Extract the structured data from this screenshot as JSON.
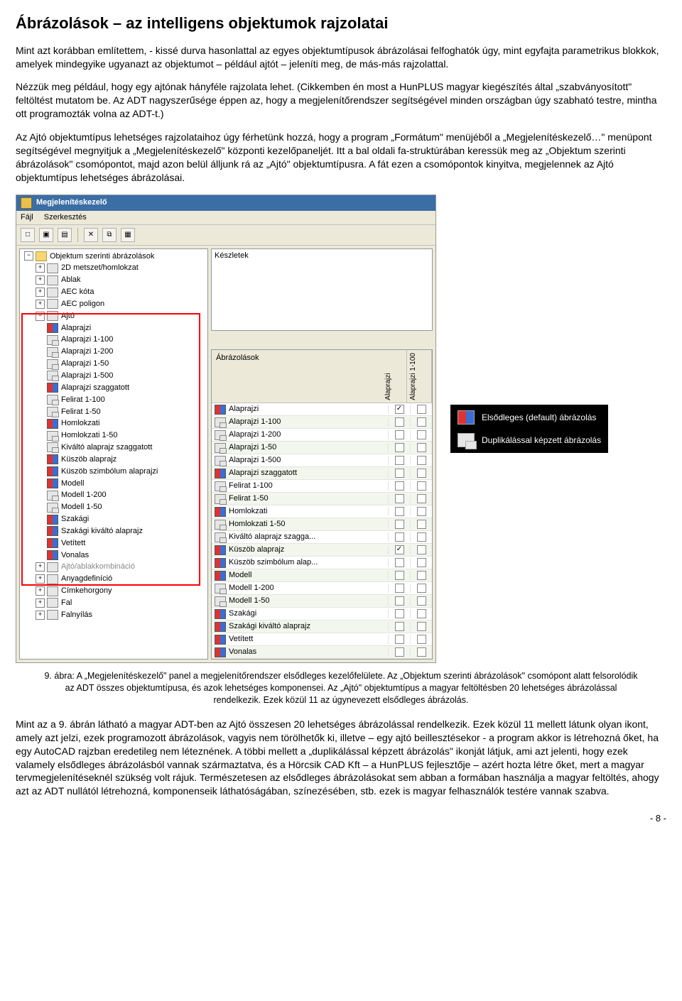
{
  "title": "Ábrázolások – az intelligens objektumok rajzolatai",
  "para1": "Mint azt korábban említettem, - kissé durva hasonlattal az egyes objektumtípusok ábrázolásai felfoghatók úgy, mint egyfajta parametrikus blokkok, amelyek mindegyike ugyanazt az objektumot – például ajtót – jeleníti meg, de más-más rajzolattal.",
  "para2": "Nézzük meg például, hogy egy ajtónak hányféle rajzolata lehet. (Cikkemben én most a HunPLUS magyar kiegészítés által „szabványosított\" feltöltést mutatom be. Az ADT nagyszerűsége éppen az, hogy a megjelenítőrendszer segítségével minden országban úgy szabható testre, mintha ott programozták volna az ADT-t.)",
  "para3": "Az Ajtó objektumtípus lehetséges rajzolataihoz úgy férhetünk hozzá, hogy a program „Formátum\" menüjéből a „Megjelenítéskezelő…\" menüpont segítségével megnyitjuk a „Megjelenítéskezelő\" központi kezelőpaneljét. Itt a bal oldali fa-struktúrában keressük meg az „Objektum szerinti ábrázolások\" csomópontot, majd azon belül álljunk rá az „Ajtó\" objektumtípusra. A fát ezen a csomópontok kinyitva, megjelennek az Ajtó objektumtípus lehetséges ábrázolásai.",
  "caption": "9. ábra: A „Megjelenítéskezelő\" panel a megjelenítőrendszer elsődleges kezelőfelülete. Az „Objektum szerinti ábrázolások\" csomópont alatt felsorolódik az ADT összes objektumtípusa, és azok lehetséges komponensei. Az „Ajtó\" objektumtípus a magyar feltöltésben 20 lehetséges ábrázolással rendelkezik. Ezek közül 11 az úgynevezett elsődleges ábrázolás.",
  "para4": "Mint az a 9. ábrán látható a magyar ADT-ben az Ajtó összesen 20 lehetséges ábrázolással rendelkezik. Ezek közül 11 mellett látunk olyan ikont, amely azt jelzi, ezek programozott ábrázolások, vagyis nem törölhetők ki, illetve – egy ajtó beillesztésekor - a program akkor is létrehozná őket, ha egy AutoCAD rajzban eredetileg nem léteznének. A többi mellett a „duplikálással képzett ábrázolás\" ikonját látjuk, ami azt jelenti, hogy ezek valamely elsődleges ábrázolásból vannak származtatva, és a Hörcsik CAD Kft – a HunPLUS fejlesztője – azért hozta létre őket, mert a magyar tervmegjelenítéseknél szükség volt rájuk. Természetesen az elsődleges ábrázolásokat sem abban a formában használja a magyar feltöltés, ahogy azt az ADT nullától létrehozná, komponenseik láthatóságában, színezésében, stb. ezek is magyar felhasználók testére vannak szabva.",
  "page": "- 8 -",
  "ui": {
    "title": "Megjelenítéskezelő",
    "menu": {
      "file": "Fájl",
      "edit": "Szerkesztés"
    },
    "rootNode": "Objektum szerinti ábrázolások",
    "topNodes": [
      "2D metszet/homlokzat",
      "Ablak",
      "AEC kóta",
      "AEC poligon"
    ],
    "ajto": "Ajtó",
    "ajtoChildren": [
      {
        "label": "Alaprajzi",
        "icon": "primary"
      },
      {
        "label": "Alaprajzi 1-100",
        "icon": "dup"
      },
      {
        "label": "Alaprajzi 1-200",
        "icon": "dup"
      },
      {
        "label": "Alaprajzi 1-50",
        "icon": "dup"
      },
      {
        "label": "Alaprajzi 1-500",
        "icon": "dup"
      },
      {
        "label": "Alaprajzi szaggatott",
        "icon": "primary"
      },
      {
        "label": "Felirat 1-100",
        "icon": "dup"
      },
      {
        "label": "Felirat 1-50",
        "icon": "dup"
      },
      {
        "label": "Homlokzati",
        "icon": "primary"
      },
      {
        "label": "Homlokzati 1-50",
        "icon": "dup"
      },
      {
        "label": "Kiváltó alaprajz szaggatott",
        "icon": "dup"
      },
      {
        "label": "Küszöb alaprajz",
        "icon": "primary"
      },
      {
        "label": "Küszöb szimbólum alaprajzi",
        "icon": "primary"
      },
      {
        "label": "Modell",
        "icon": "primary"
      },
      {
        "label": "Modell 1-200",
        "icon": "dup"
      },
      {
        "label": "Modell 1-50",
        "icon": "dup"
      },
      {
        "label": "Szakági",
        "icon": "primary"
      },
      {
        "label": "Szakági kiváltó alaprajz",
        "icon": "primary"
      },
      {
        "label": "Vetített",
        "icon": "primary"
      },
      {
        "label": "Vonalas",
        "icon": "primary"
      }
    ],
    "ajtoTrunc": "Ajtó/ablakkombináció",
    "bottomNodes": [
      "Anyagdefiníció",
      "Címkehorgony",
      "Fal",
      "Falnyílás"
    ],
    "keszletLabel": "Készletek",
    "matrixLabel": "Ábrázolások",
    "colRot1": "Alaprajzi",
    "colRot2": "Alaprajzi 1-100",
    "matrix": [
      {
        "label": "Alaprajzi",
        "icon": "primary",
        "c1": true,
        "c2": false
      },
      {
        "label": "Alaprajzi 1-100",
        "icon": "dup",
        "c1": false,
        "c2": false
      },
      {
        "label": "Alaprajzi 1-200",
        "icon": "dup",
        "c1": false,
        "c2": false
      },
      {
        "label": "Alaprajzi 1-50",
        "icon": "dup",
        "c1": false,
        "c2": false
      },
      {
        "label": "Alaprajzi 1-500",
        "icon": "dup",
        "c1": false,
        "c2": false
      },
      {
        "label": "Alaprajzi szaggatott",
        "icon": "primary",
        "c1": false,
        "c2": false
      },
      {
        "label": "Felirat 1-100",
        "icon": "dup",
        "c1": false,
        "c2": false
      },
      {
        "label": "Felirat 1-50",
        "icon": "dup",
        "c1": false,
        "c2": false
      },
      {
        "label": "Homlokzati",
        "icon": "primary",
        "c1": false,
        "c2": false
      },
      {
        "label": "Homlokzati 1-50",
        "icon": "dup",
        "c1": false,
        "c2": false
      },
      {
        "label": "Kiváltó alaprajz szagga...",
        "icon": "dup",
        "c1": false,
        "c2": false
      },
      {
        "label": "Küszöb alaprajz",
        "icon": "primary",
        "c1": true,
        "c2": false
      },
      {
        "label": "Küszöb szimbólum alap...",
        "icon": "primary",
        "c1": false,
        "c2": false
      },
      {
        "label": "Modell",
        "icon": "primary",
        "c1": false,
        "c2": false
      },
      {
        "label": "Modell 1-200",
        "icon": "dup",
        "c1": false,
        "c2": false
      },
      {
        "label": "Modell 1-50",
        "icon": "dup",
        "c1": false,
        "c2": false
      },
      {
        "label": "Szakági",
        "icon": "primary",
        "c1": false,
        "c2": false
      },
      {
        "label": "Szakági kiváltó alaprajz",
        "icon": "primary",
        "c1": false,
        "c2": false
      },
      {
        "label": "Vetített",
        "icon": "primary",
        "c1": false,
        "c2": false
      },
      {
        "label": "Vonalas",
        "icon": "primary",
        "c1": false,
        "c2": false
      }
    ],
    "legend": {
      "primary": "Elsődleges (default) ábrázolás",
      "dup": "Duplikálással képzett ábrázolás"
    }
  }
}
